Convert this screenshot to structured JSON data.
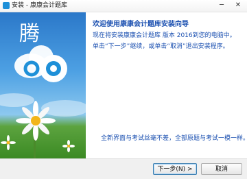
{
  "window": {
    "title": "安装 - 康康会计题库",
    "minimize_glyph": "─",
    "close_glyph": "✕"
  },
  "banner": {
    "brand_char": "腾"
  },
  "content": {
    "heading": "欢迎使用康康会计题库安装向导",
    "line1": "现在将安装康康会计题库 版本 2016到您的电脑中。",
    "line2": "单击“下一步”继续，或单击“取消”退出安装程序。",
    "footer_note": "全新界面与考试丝毫不差，全部原题与考试一模一样。"
  },
  "buttons": {
    "next_label": "下一步(N) >",
    "cancel_label": "取消"
  },
  "colors": {
    "text_blue": "#1a4fb0",
    "logo_blue": "#1e90d8"
  }
}
